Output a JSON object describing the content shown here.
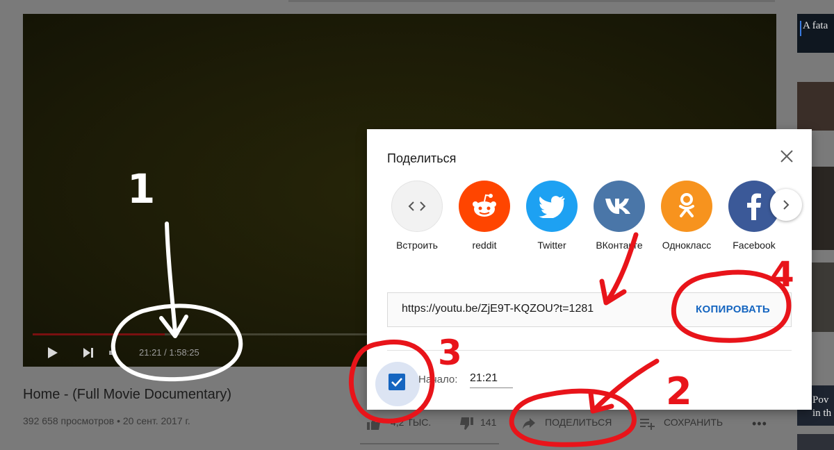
{
  "player": {
    "time_display": "21:21 / 1:58:25",
    "progress": 0.18
  },
  "video": {
    "title": "Home - (Full Movie Documentary)",
    "meta": "392 658 просмотров • 20 сент. 2017 г.",
    "likes": "4,2 ТЫС.",
    "dislikes": "141",
    "share_label": "ПОДЕЛИТЬСЯ",
    "save_label": "СОХРАНИТЬ",
    "more_label": "•••"
  },
  "sidebar": {
    "thumb1_text": "A fata",
    "thumb5_text": "Pov in th"
  },
  "share_dialog": {
    "title": "Поделиться",
    "targets": [
      {
        "label": "Встроить",
        "icon": "embed-icon",
        "color": "#f2f2f2"
      },
      {
        "label": "reddit",
        "icon": "reddit-icon",
        "color": "#ff4500"
      },
      {
        "label": "Twitter",
        "icon": "twitter-icon",
        "color": "#1da1f2"
      },
      {
        "label": "ВКонтакте",
        "icon": "vk-icon",
        "color": "#4a76a8"
      },
      {
        "label": "Однокласс",
        "icon": "odnoklassniki-icon",
        "color": "#f7931e"
      },
      {
        "label": "Facebook",
        "icon": "facebook-icon",
        "color": "#3b5998"
      }
    ],
    "url": "https://youtu.be/ZjE9T-KQZOU?t=1281",
    "copy_label": "КОПИРОВАТЬ",
    "start_label": "Начало:",
    "start_value": "21:21",
    "start_checked": true
  },
  "annotations": [
    "1",
    "2",
    "3",
    "4"
  ],
  "colors": {
    "accent_blue": "#1565c0",
    "annotation_red": "#e8141a",
    "annotation_white": "#ffffff"
  }
}
